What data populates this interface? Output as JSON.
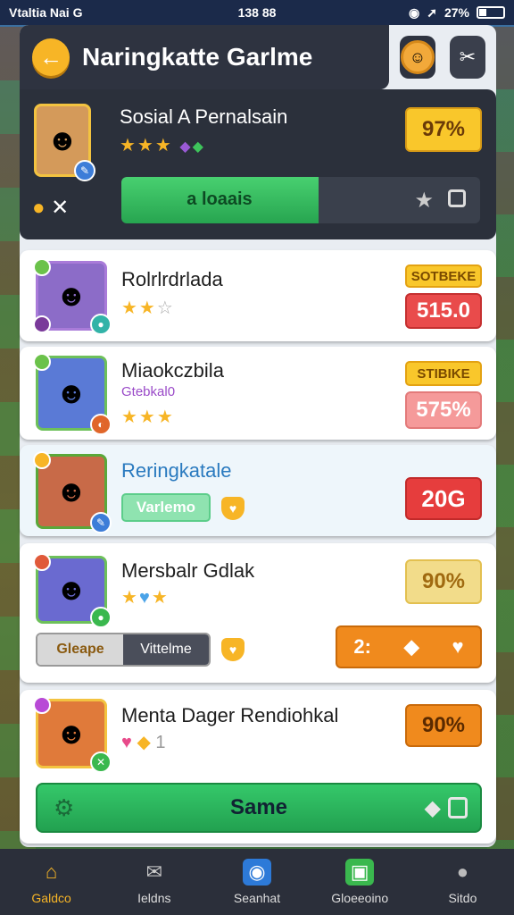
{
  "status": {
    "carrier": "Vtaltia Nai G",
    "time": "138 88",
    "battery": "27%"
  },
  "header": {
    "title": "Naringkatte Garlme"
  },
  "top": {
    "name": "Sosial A Pernalsain",
    "percent": "97%",
    "bar_label": "a loaais",
    "progress": 0.55
  },
  "cards": [
    {
      "name": "Rolrlrdrlada",
      "tag": "SOTBEKE",
      "value": "515.0"
    },
    {
      "name": "Miaokczbila",
      "sub": "Gtebkal0",
      "tag": "STIBIKE",
      "value": "575%"
    },
    {
      "name": "Reringkatale",
      "button": "Varlemo",
      "value": "20G"
    },
    {
      "name": "Mersbalr Gdlak",
      "value": "90%",
      "btn_left": "Gleape",
      "btn_right": "Vittelme",
      "action_label": "2:"
    },
    {
      "name": "Menta Dager Rendiohkal",
      "value": "90%",
      "stars_text": "1"
    }
  ],
  "main_button": "Same",
  "nav": [
    "Galdco",
    "Ieldns",
    "Seanhat",
    "Gloeeoino",
    "Sitdo"
  ],
  "colors": {
    "accent": "#f7b526",
    "green": "#2fb561",
    "red": "#e34b4b",
    "orange": "#f08a1d"
  }
}
